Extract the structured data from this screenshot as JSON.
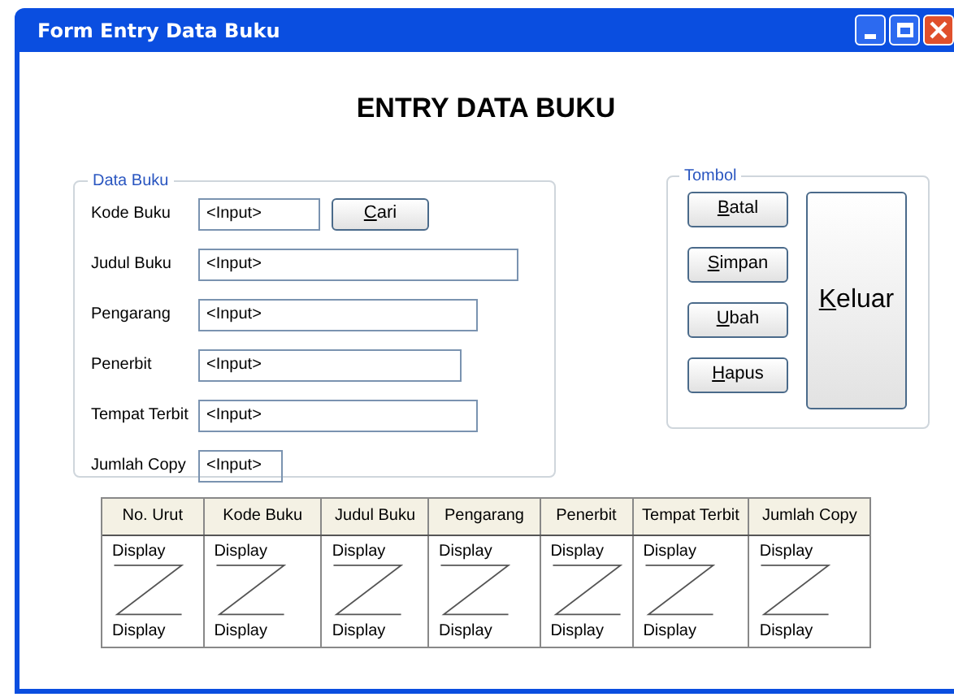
{
  "window": {
    "title": "Form Entry Data Buku"
  },
  "heading": "ENTRY DATA BUKU",
  "data_buku": {
    "legend": "Data Buku",
    "fields": [
      {
        "label": "Kode Buku",
        "value": "<Input>",
        "button": "Cari"
      },
      {
        "label": "Judul Buku",
        "value": "<Input>"
      },
      {
        "label": "Pengarang",
        "value": "<Input>"
      },
      {
        "label": "Penerbit",
        "value": "<Input>"
      },
      {
        "label": "Tempat Terbit",
        "value": "<Input>"
      },
      {
        "label": "Jumlah Copy",
        "value": "<Input>"
      }
    ]
  },
  "tombol": {
    "legend": "Tombol",
    "buttons": [
      "Batal",
      "Simpan",
      "Ubah",
      "Hapus"
    ],
    "exit_button": "Keluar"
  },
  "table": {
    "columns": [
      "No. Urut",
      "Kode Buku",
      "Judul Buku",
      "Pengarang",
      "Penerbit",
      "Tempat Terbit",
      "Jumlah Copy"
    ],
    "rows": [
      {
        "cells": [
          {
            "top": "Display",
            "bottom": "Display"
          },
          {
            "top": "Display",
            "bottom": "Display"
          },
          {
            "top": "Display",
            "bottom": "Display"
          },
          {
            "top": "Display",
            "bottom": "Display"
          },
          {
            "top": "Display",
            "bottom": "Display"
          },
          {
            "top": "Display",
            "bottom": "Display"
          },
          {
            "top": "Display",
            "bottom": "Display"
          }
        ]
      }
    ]
  }
}
